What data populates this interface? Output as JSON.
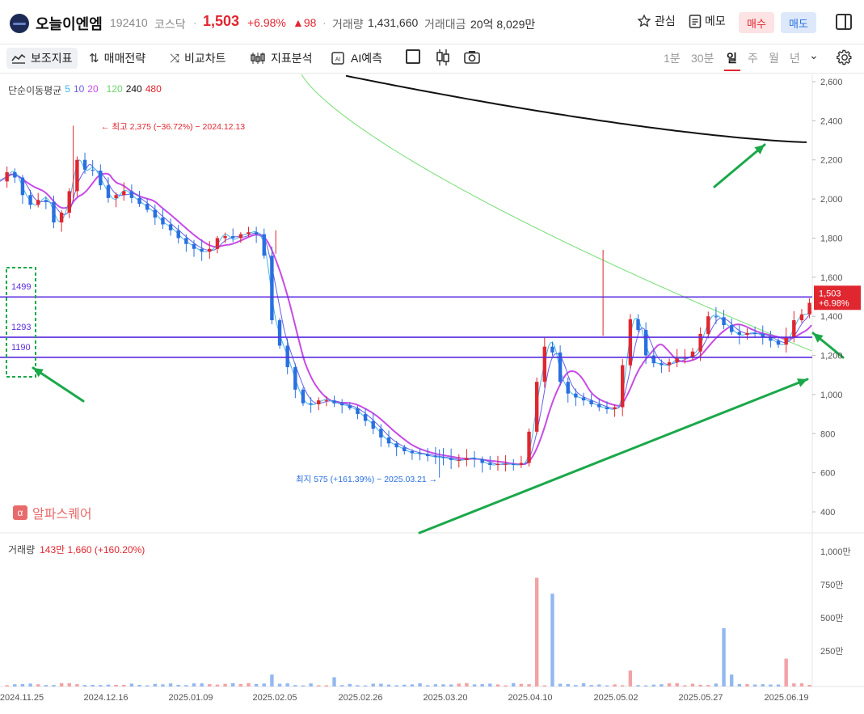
{
  "header": {
    "stock_name": "오늘이엔엠",
    "stock_code": "192410",
    "market": "코스닥",
    "separator": "·",
    "price": "1,503",
    "change_pct": "+6.98%",
    "change_amt": "▲98",
    "volume_label": "거래량",
    "volume_value": "1,431,660",
    "amount_label": "거래대금",
    "amount_value": "20억 8,029만",
    "fav_label": "관심",
    "memo_label": "메모",
    "buy_label": "매수",
    "sell_label": "매도"
  },
  "toolbar": {
    "items": [
      "보조지표",
      "매매전략",
      "비교차트",
      "지표분석",
      "AI예측"
    ],
    "periods": [
      "1분",
      "30분",
      "일",
      "주",
      "월",
      "년"
    ],
    "selected_period": "일"
  },
  "legend": {
    "ma_title": "단순이동평균",
    "ma_periods": [
      "5",
      "10",
      "20",
      "120",
      "240",
      "480"
    ],
    "volume_title": "거래량",
    "volume_info": "143만 1,660 (+160.20%)",
    "watermark": "알파스퀘어"
  },
  "annotations": {
    "high": "최고 2,375 (−36.72%) − 2024.12.13",
    "low": "최지 575 (+161.39%) − 2025.03.21",
    "level_labels": [
      "1499",
      "1293",
      "1190"
    ],
    "price_tag": "1,503",
    "price_tag_pct": "+6.98%"
  },
  "colors": {
    "up": "#e0262f",
    "down": "#2a6fe0",
    "ma5": "#3fb6e8",
    "ma10": "#6a5ee8",
    "ma20": "#c84be6",
    "ma120": "#7fe07f",
    "ma240": "#111111",
    "ma480": "#e0262f",
    "level": "#5a2be0",
    "arrow": "#1aa84a"
  },
  "chart_data": {
    "type": "candlestick",
    "y_axis": {
      "min": 400,
      "max": 2600,
      "ticks": [
        "2,600",
        "2,400",
        "2,200",
        "2,000",
        "1,800",
        "1,600",
        "1,400",
        "1,200",
        "1,000",
        "800",
        "600",
        "400"
      ]
    },
    "volume_axis": {
      "ticks": [
        "1,000만",
        "750만",
        "500만",
        "250만"
      ]
    },
    "x_ticks": [
      "2024.11.25",
      "2024.12.16",
      "2025.01.09",
      "2025.02.05",
      "2025.02.26",
      "2025.03.20",
      "2025.04.10",
      "2025.05.02",
      "2025.05.27",
      "2025.06.19"
    ],
    "levels": [
      1499,
      1293,
      1190
    ],
    "last_price": 1503
  }
}
